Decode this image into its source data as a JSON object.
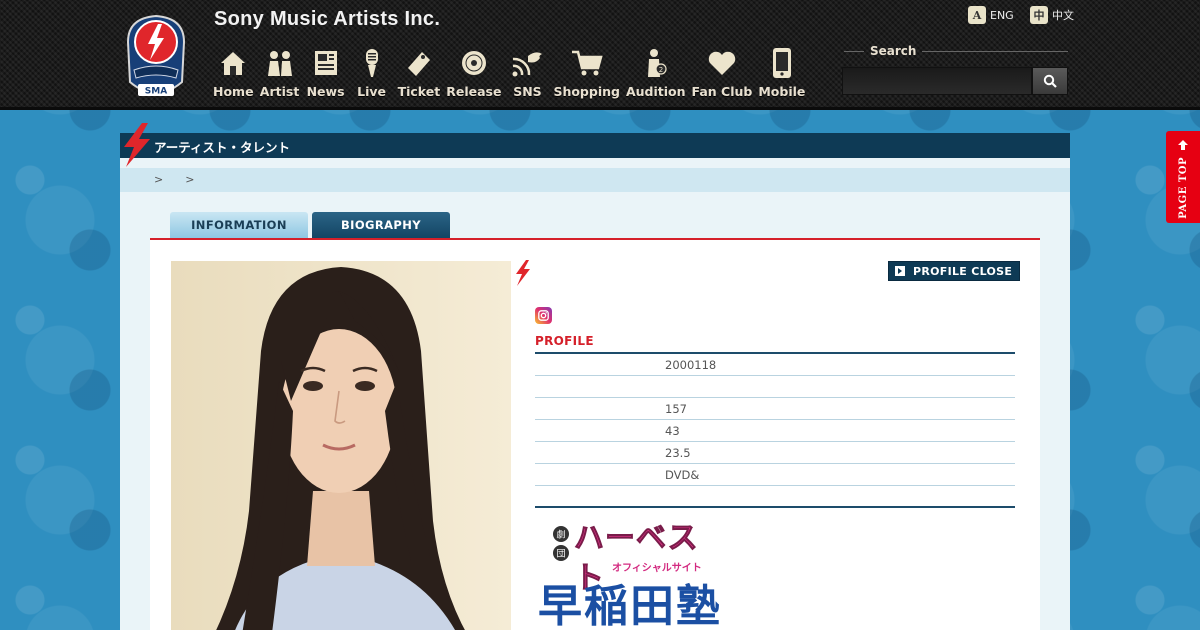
{
  "header": {
    "site_title": "Sony Music Artists Inc.",
    "logo_text": "SMA",
    "nav": [
      {
        "label": "Home",
        "icon": "home-icon"
      },
      {
        "label": "Artist",
        "icon": "people-icon"
      },
      {
        "label": "News",
        "icon": "newspaper-icon"
      },
      {
        "label": "Live",
        "icon": "microphone-icon"
      },
      {
        "label": "Ticket",
        "icon": "ticket-icon"
      },
      {
        "label": "Release",
        "icon": "disc-icon"
      },
      {
        "label": "SNS",
        "icon": "sns-icon"
      },
      {
        "label": "Shopping",
        "icon": "cart-icon"
      },
      {
        "label": "Audition",
        "icon": "audition-icon"
      },
      {
        "label": "Fan Club",
        "icon": "heart-icon"
      },
      {
        "label": "Mobile",
        "icon": "mobile-icon"
      }
    ],
    "lang_eng": {
      "badge": "A",
      "label": "ENG"
    },
    "lang_cn": {
      "badge": "中",
      "label": "中文"
    },
    "search": {
      "label": "Search",
      "placeholder": ""
    }
  },
  "page_top": {
    "label": "PAGE TOP"
  },
  "section": {
    "title": "アーティスト・タレント"
  },
  "breadcrumb": [
    ">",
    ">"
  ],
  "tabs": {
    "information": "INFORMATION",
    "biography": "BIOGRAPHY"
  },
  "profile": {
    "close_label": "PROFILE CLOSE",
    "heading": "PROFILE",
    "rows": [
      "2000118",
      "",
      "157",
      "43",
      "23.5",
      "DVD&"
    ]
  },
  "banner": {
    "main": "ハーベスト",
    "sub": "オフィシャルサイト",
    "school": "早稲田塾"
  },
  "colors": {
    "accent_red": "#d5202a",
    "navy": "#0e3a55",
    "page_bg": "#2f8fc0"
  }
}
